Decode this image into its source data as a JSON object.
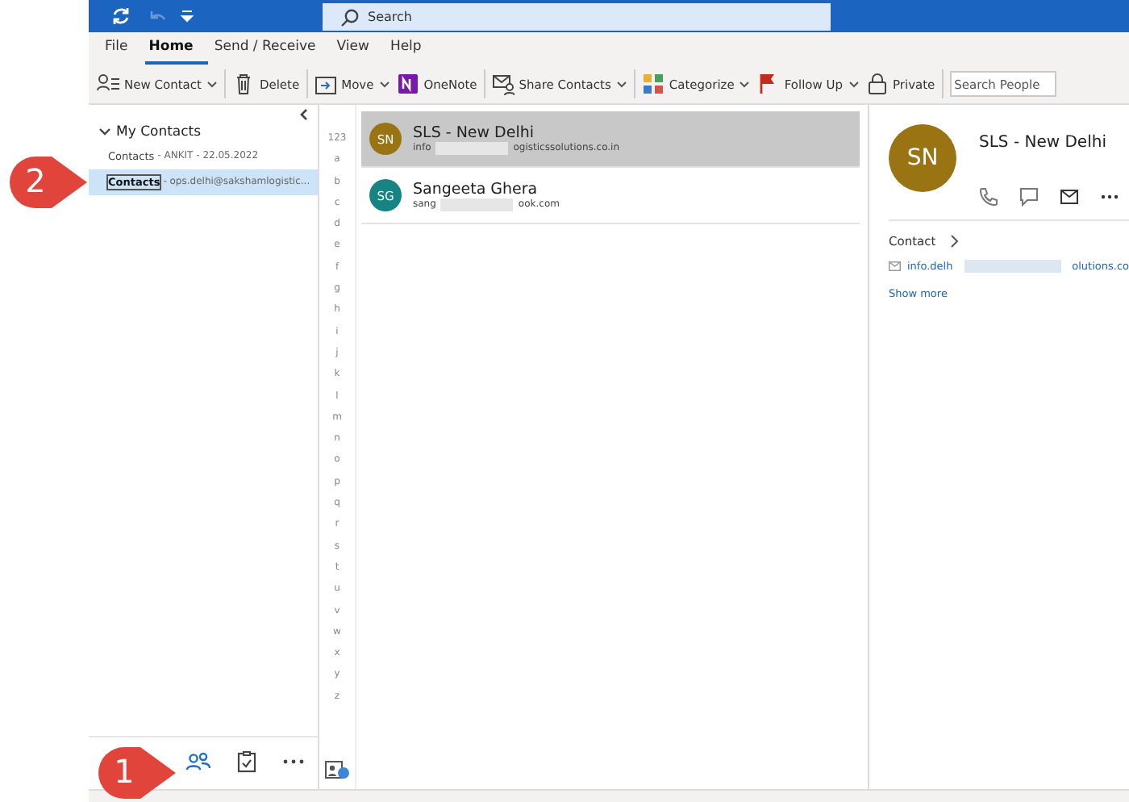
{
  "title_bar": {
    "search": {
      "placeholder": "Search"
    }
  },
  "ribbon_tabs": [
    {
      "label": "File",
      "selected": false
    },
    {
      "label": "Home",
      "selected": true
    },
    {
      "label": "Send / Receive",
      "selected": false
    },
    {
      "label": "View",
      "selected": false
    },
    {
      "label": "Help",
      "selected": false
    }
  ],
  "toolbar": {
    "buttons": [
      {
        "label": "New Contact",
        "dropdown": true
      },
      {
        "label": "Delete",
        "dropdown": false
      },
      {
        "label": "Move",
        "dropdown": true
      },
      {
        "label": "OneNote",
        "dropdown": false
      },
      {
        "label": "Share Contacts",
        "dropdown": true
      },
      {
        "label": "Categorize",
        "dropdown": true
      },
      {
        "label": "Follow Up",
        "dropdown": true
      },
      {
        "label": "Private",
        "dropdown": false
      }
    ],
    "search": {
      "placeholder": "Search People"
    }
  },
  "folder_pane": {
    "header": "My Contacts",
    "expanded": true,
    "items": [
      {
        "name": "Contacts",
        "detail": "- ANKIT - 22.05.2022",
        "selected": false
      },
      {
        "name": "Contacts",
        "detail": "- ops.delhi@sakshamlogistic...",
        "selected": true
      }
    ]
  },
  "nav_bar": [
    {
      "selected": true
    },
    {
      "selected": false
    },
    {
      "selected": false
    }
  ],
  "alphabet_index": [
    "123",
    "a",
    "b",
    "c",
    "d",
    "e",
    "f",
    "g",
    "h",
    "i",
    "j",
    "k",
    "l",
    "m",
    "n",
    "o",
    "p",
    "q",
    "r",
    "s",
    "t",
    "u",
    "v",
    "w",
    "x",
    "y",
    "z"
  ],
  "contacts": [
    {
      "initials": "SN",
      "name": "SLS - New Delhi",
      "email_start": "info",
      "email_end": "ogisticssolutions.co.in",
      "color": "#9a7413",
      "selected": true
    },
    {
      "initials": "SG",
      "name": "Sangeeta Ghera",
      "email_start": "sang",
      "email_end": "ook.com",
      "color": "#158483",
      "selected": false
    }
  ],
  "reading_pane": {
    "initials": "SN",
    "name": "SLS - New Delhi",
    "color": "#9a7413",
    "section": "Contact",
    "email_start": "info.delh",
    "email_end": "olutions.co",
    "link": "Show more"
  },
  "callouts": [
    {
      "number": "2"
    },
    {
      "number": "1"
    }
  ]
}
